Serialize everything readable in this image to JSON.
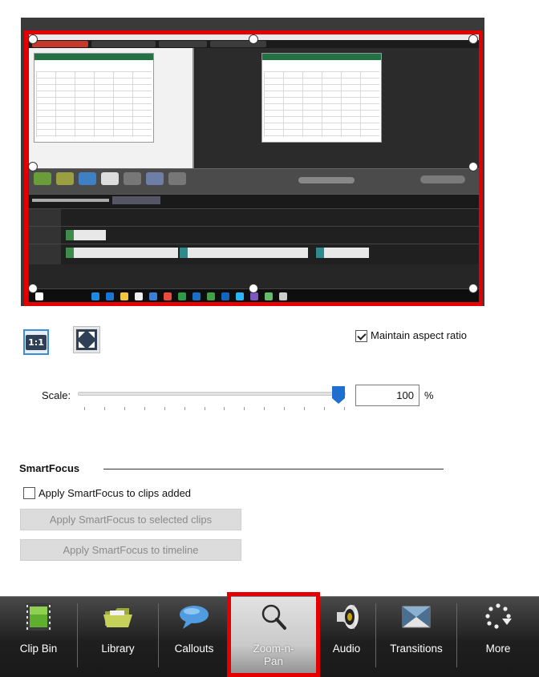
{
  "preview": {
    "frame_color": "#e40000"
  },
  "controls": {
    "one_to_one_label": "1:1",
    "fit_icon": "expand-arrows-icon",
    "maintain_aspect_label": "Maintain aspect ratio",
    "maintain_aspect_checked": true,
    "scale_label": "Scale:",
    "scale_value": "100",
    "scale_unit": "%",
    "scale_slider_fraction": 1.0
  },
  "smartfocus": {
    "title": "SmartFocus",
    "apply_clips_added_label": "Apply SmartFocus to clips added",
    "apply_clips_added_checked": false,
    "apply_selected_label": "Apply SmartFocus to selected clips",
    "apply_timeline_label": "Apply SmartFocus to timeline"
  },
  "tabs": [
    {
      "label": "Clip Bin",
      "icon": "film-strip-icon",
      "active": false
    },
    {
      "label": "Library",
      "icon": "folder-icon",
      "active": false
    },
    {
      "label": "Callouts",
      "icon": "speech-bubble-icon",
      "active": false
    },
    {
      "label": "Zoom-n-Pan",
      "icon": "magnifier-icon",
      "active": true
    },
    {
      "label": "Audio",
      "icon": "speaker-icon",
      "active": false
    },
    {
      "label": "Transitions",
      "icon": "transition-icon",
      "active": false
    },
    {
      "label": "More",
      "icon": "more-dots-icon",
      "active": false
    }
  ],
  "colors": {
    "accent": "#1e6fce",
    "highlight": "#e40000"
  }
}
